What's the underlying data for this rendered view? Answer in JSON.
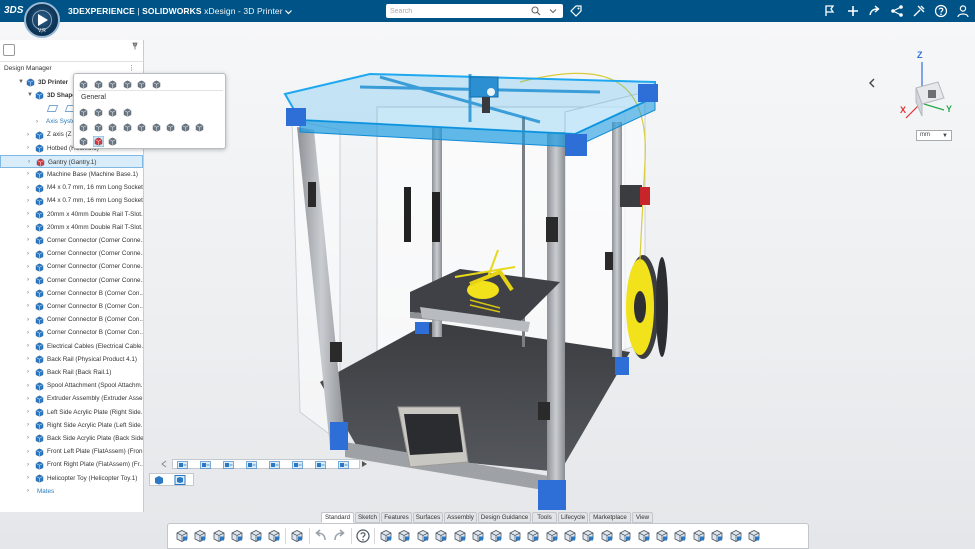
{
  "window": {
    "brand_logo": "3DS",
    "brand": "3DEXPERIENCE",
    "separator": " | ",
    "product": "SOLIDWORKS",
    "app": "xDesign",
    "document": "3D Printer",
    "compass_label": "V,R"
  },
  "search": {
    "placeholder": "Search"
  },
  "design_manager": {
    "title": "Design Manager",
    "items": [
      {
        "label": "3D Printer",
        "depth": 0,
        "expanded": true,
        "bold": true
      },
      {
        "label": "3D Shape",
        "depth": 1,
        "expanded": true,
        "bold": true
      },
      {
        "label": "",
        "depth": 2,
        "expanded": null
      },
      {
        "label": "Axis Systems",
        "depth": 2,
        "expanded": false,
        "link": true
      },
      {
        "label": "Z axis (Z axis",
        "depth": 1,
        "expanded": false
      },
      {
        "label": "Hotbed (Hotbed.1)",
        "depth": 1,
        "expanded": false
      },
      {
        "label": "Gantry (Gantry.1)",
        "depth": 1,
        "expanded": false,
        "selected": true
      },
      {
        "label": "Machine Base (Machine Base.1)",
        "depth": 1,
        "expanded": false
      },
      {
        "label": "M4 x 0.7 mm, 16 mm Long Socket...",
        "depth": 1,
        "expanded": false
      },
      {
        "label": "M4 x 0.7 mm, 16 mm Long Socket...",
        "depth": 1,
        "expanded": false
      },
      {
        "label": "20mm x 40mm Double Rail T-Slot...",
        "depth": 1,
        "expanded": false
      },
      {
        "label": "20mm x 40mm Double Rail T-Slot...",
        "depth": 1,
        "expanded": false
      },
      {
        "label": "Corner Connector (Corner Conne...",
        "depth": 1,
        "expanded": false
      },
      {
        "label": "Corner Connector (Corner Conne...",
        "depth": 1,
        "expanded": false
      },
      {
        "label": "Corner Connector (Corner Conne...",
        "depth": 1,
        "expanded": false
      },
      {
        "label": "Corner Connector (Corner Conne...",
        "depth": 1,
        "expanded": false
      },
      {
        "label": "Corner Connector B (Corner Con...",
        "depth": 1,
        "expanded": false
      },
      {
        "label": "Corner Connector B (Corner Con...",
        "depth": 1,
        "expanded": false
      },
      {
        "label": "Corner Connector B (Corner Con...",
        "depth": 1,
        "expanded": false
      },
      {
        "label": "Corner Connector B (Corner Con...",
        "depth": 1,
        "expanded": false
      },
      {
        "label": "Electrical Cables (Electrical Cable...",
        "depth": 1,
        "expanded": false
      },
      {
        "label": "Back Rail (Physical Product 4.1)",
        "depth": 1,
        "expanded": false
      },
      {
        "label": "Back Rail (Back Rail.1)",
        "depth": 1,
        "expanded": false
      },
      {
        "label": "Spool Attachment (Spool Attachm...",
        "depth": 1,
        "expanded": false
      },
      {
        "label": "Extruder Assembly (Extruder Asse...",
        "depth": 1,
        "expanded": false
      },
      {
        "label": "Left Side Acrylic Plate (Right Side...",
        "depth": 1,
        "expanded": false
      },
      {
        "label": "Right Side Acrylic Plate (Left Side...",
        "depth": 1,
        "expanded": false
      },
      {
        "label": "Back Side Acrylic Plate (Back Side...",
        "depth": 1,
        "expanded": false
      },
      {
        "label": "Front Left Plate (FlatAssem) (Fron...",
        "depth": 1,
        "expanded": false
      },
      {
        "label": "Front Right Plate (FlatAssem) (Fr...",
        "depth": 1,
        "expanded": false
      },
      {
        "label": "Helicopter Toy (Helicopter Toy.1)",
        "depth": 1,
        "expanded": false
      },
      {
        "label": "Mates",
        "depth": 1,
        "expanded": false,
        "link": true
      }
    ]
  },
  "context_toolbar": {
    "section_label": "General",
    "row1_icons": [
      "insert-part-icon",
      "insert-component-icon",
      "edit-icon",
      "copy-icon",
      "pattern-icon",
      "mate-icon"
    ],
    "row2_icons": [
      "hide-icon",
      "select-icon",
      "replace-icon",
      "update-icon"
    ],
    "row3_icons": [
      "measure-icon",
      "isolate-icon",
      "explode-icon",
      "appearance-icon",
      "properties-icon",
      "section-icon",
      "display-icon",
      "rename-icon",
      "zoom-icon"
    ],
    "row4_icons": [
      "list-icon",
      "gantry-cube-icon",
      "open-icon"
    ]
  },
  "units": {
    "value": "mm"
  },
  "view_cube": {
    "x": "X",
    "y": "Y",
    "z": "Z"
  },
  "action_tabs": [
    {
      "label": "Standard",
      "active": true
    },
    {
      "label": "Sketch"
    },
    {
      "label": "Features"
    },
    {
      "label": "Surfaces"
    },
    {
      "label": "Assembly"
    },
    {
      "label": "Design Guidance"
    },
    {
      "label": "Tools"
    },
    {
      "label": "Lifecycle"
    },
    {
      "label": "Marketplace"
    },
    {
      "label": "View"
    }
  ],
  "colors": {
    "topbar": "#005386",
    "frame": "#b0b4b8",
    "corner": "#2d6fd6",
    "gantry_highlight": "#1da8f0",
    "filament": "#f2e21b",
    "selection": "#d9ecfa"
  }
}
